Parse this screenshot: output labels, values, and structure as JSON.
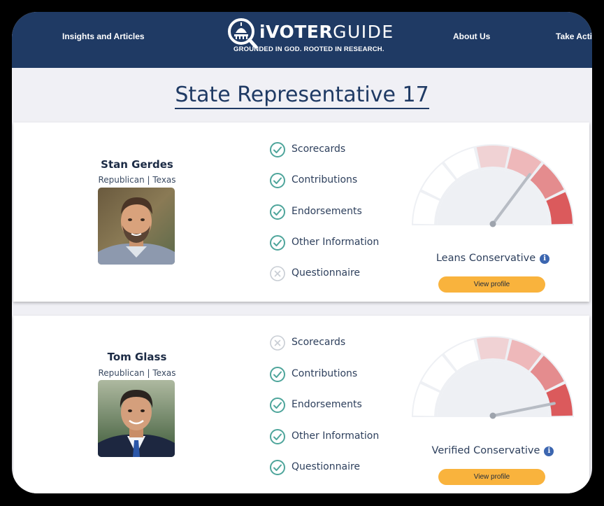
{
  "nav": {
    "insights": "Insights and Articles",
    "about": "About Us",
    "take_action": "Take Action"
  },
  "logo": {
    "brand_prefix": "i",
    "brand_voter": "VOTER",
    "brand_guide": "GUIDE",
    "tagline": "GROUNDED IN GOD. ROOTED IN RESEARCH."
  },
  "page": {
    "title": "State Representative 17"
  },
  "colors": {
    "header_bg": "#1f3a64",
    "check_teal": "#4ea59b",
    "cross_gray": "#c8cdd4",
    "button_orange": "#f9b33d",
    "gauge_red_1": "#f0d2d4",
    "gauge_red_2": "#eeb8ba",
    "gauge_red_3": "#e48c8e",
    "gauge_red_4": "#db5a5c",
    "info_blue": "#3c66b0"
  },
  "candidates": [
    {
      "name": "Stan Gerdes",
      "party": "Republican | Texas",
      "checklist": [
        {
          "label": "Scorecards",
          "status": "check"
        },
        {
          "label": "Contributions",
          "status": "check"
        },
        {
          "label": "Endorsements",
          "status": "check"
        },
        {
          "label": "Other Information",
          "status": "check"
        },
        {
          "label": "Questionnaire",
          "status": "cross"
        }
      ],
      "rating": "Leans Conservative",
      "gauge_level": 0.7,
      "button": "View profile"
    },
    {
      "name": "Tom Glass",
      "party": "Republican | Texas",
      "checklist": [
        {
          "label": "Scorecards",
          "status": "cross"
        },
        {
          "label": "Contributions",
          "status": "check"
        },
        {
          "label": "Endorsements",
          "status": "check"
        },
        {
          "label": "Other Information",
          "status": "check"
        },
        {
          "label": "Questionnaire",
          "status": "check"
        }
      ],
      "rating": "Verified Conservative",
      "gauge_level": 0.93,
      "button": "View profile"
    }
  ]
}
